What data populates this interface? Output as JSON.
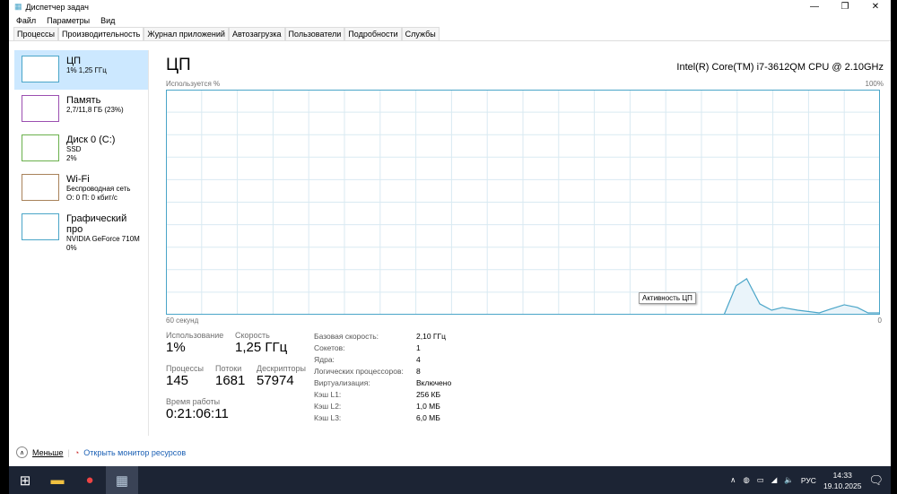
{
  "window": {
    "title": "Диспетчер задач"
  },
  "menu": [
    "Файл",
    "Параметры",
    "Вид"
  ],
  "tabs": [
    "Процессы",
    "Производительность",
    "Журнал приложений",
    "Автозагрузка",
    "Пользователи",
    "Подробности",
    "Службы"
  ],
  "sidebar": [
    {
      "title": "ЦП",
      "l1": "1% 1,25 ГГц",
      "l2": "",
      "color": "#4aa5c8"
    },
    {
      "title": "Память",
      "l1": "2,7/11,8 ГБ (23%)",
      "l2": "",
      "color": "#9b4fb0"
    },
    {
      "title": "Диск 0 (C:)",
      "l1": "SSD",
      "l2": "2%",
      "color": "#6ab04c"
    },
    {
      "title": "Wi-Fi",
      "l1": "Беспроводная сеть",
      "l2": "О: 0 П: 0 кбит/с",
      "color": "#a8825a"
    },
    {
      "title": "Графический про",
      "l1": "NVIDIA GeForce 710M",
      "l2": "0%",
      "color": "#4aa5c8"
    }
  ],
  "main": {
    "title": "ЦП",
    "cpu_name": "Intel(R) Core(TM) i7-3612QM CPU @ 2.10GHz",
    "y_label": "Используется %",
    "y_max": "100%",
    "x_left": "60 секунд",
    "x_right": "0",
    "tooltip": "Активность ЦП"
  },
  "chart_data": {
    "type": "area",
    "x_label": "секунд назад",
    "x_range": [
      60,
      0
    ],
    "ylim": [
      0,
      100
    ],
    "x": [
      60,
      13.1,
      12.1,
      11.2,
      10.1,
      9.1,
      8.2,
      6.9,
      5.1,
      4.2,
      3.0,
      1.9,
      1.0,
      0
    ],
    "values": [
      0,
      0,
      12.8,
      16,
      4.8,
      2,
      3.2,
      2,
      0.8,
      2.4,
      4.4,
      3.2,
      0.8,
      0.8
    ]
  },
  "stats": {
    "usage_label": "Использование",
    "usage": "1%",
    "speed_label": "Скорость",
    "speed": "1,25 ГГц",
    "proc_label": "Процессы",
    "proc": "145",
    "threads_label": "Потоки",
    "threads": "1681",
    "handles_label": "Дескрипторы",
    "handles": "57974",
    "uptime_label": "Время работы",
    "uptime": "0:21:06:11"
  },
  "specs": [
    [
      "Базовая скорость:",
      "2,10 ГГц"
    ],
    [
      "Сокетов:",
      "1"
    ],
    [
      "Ядра:",
      "4"
    ],
    [
      "Логических процессоров:",
      "8"
    ],
    [
      "Виртуализация:",
      "Включено"
    ],
    [
      "Кэш L1:",
      "256 КБ"
    ],
    [
      "Кэш L2:",
      "1,0 МБ"
    ],
    [
      "Кэш L3:",
      "6,0 МБ"
    ]
  ],
  "footer": {
    "less": "Меньше",
    "monitor": "Открыть монитор ресурсов"
  },
  "taskbar": {
    "lang": "РУС",
    "time": "14:33",
    "date": "19.10.2025"
  }
}
